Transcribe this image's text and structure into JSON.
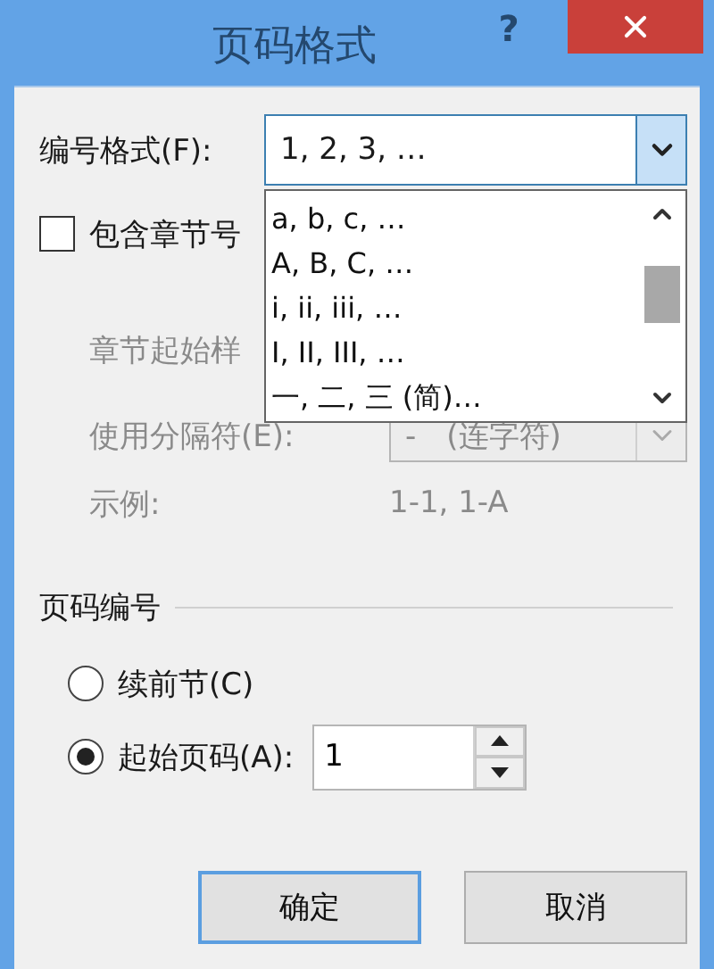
{
  "window": {
    "title": "页码格式",
    "help": "?"
  },
  "number_format": {
    "label": "编号格式(F):",
    "value": "1, 2, 3, …",
    "expanded": true,
    "options": [
      {
        "label": "a, b, c, …",
        "selected": false
      },
      {
        "label": "A, B, C, …",
        "selected": false
      },
      {
        "label": "i, ii, iii, …",
        "selected": false
      },
      {
        "label": "I, II, III, …",
        "selected": false
      },
      {
        "label": "一, 二, 三 (简)…",
        "selected": false
      }
    ]
  },
  "include_chapter": {
    "label": "包含章节号",
    "checked": false
  },
  "chapter_style": {
    "label": "章节起始样",
    "disabled": true
  },
  "separator": {
    "label": "使用分隔符(E):",
    "value": "-　(连字符)",
    "disabled": true
  },
  "example": {
    "label": "示例:",
    "value": "1-1, 1-A",
    "disabled": true
  },
  "page_numbering": {
    "title": "页码编号",
    "start_at": "1",
    "options": [
      {
        "label": "续前节(C)",
        "selected": false
      },
      {
        "label": "起始页码(A):",
        "selected": true
      }
    ]
  },
  "buttons": [
    "确定",
    "取消"
  ]
}
